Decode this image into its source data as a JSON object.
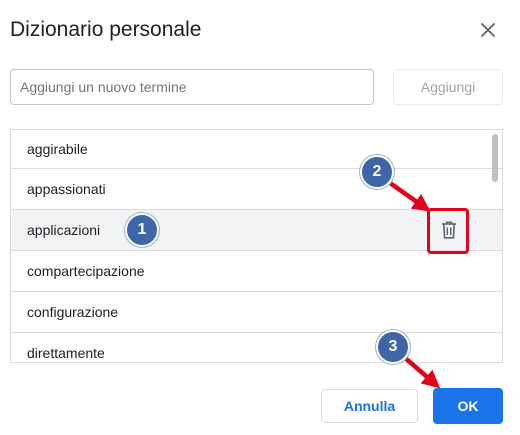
{
  "dialog": {
    "title": "Dizionario personale",
    "close_icon": "close-icon",
    "input": {
      "value": "",
      "placeholder": "Aggiungi un nuovo termine"
    },
    "add_label": "Aggiungi",
    "words": [
      "aggirabile",
      "appassionati",
      "applicazioni",
      "compartecipazione",
      "configurazione",
      "direttamente"
    ],
    "hovered_word_index": 2,
    "delete_icon": "trash-icon",
    "cancel_label": "Annulla",
    "ok_label": "OK"
  },
  "annotations": {
    "badges": [
      "1",
      "2",
      "3"
    ],
    "badge_color": "#3f67a8",
    "arrow_color": "#e3001b"
  },
  "colors": {
    "accent": "#1a73e8",
    "hover_row": "#f1f3f4",
    "border": "#dadce0"
  }
}
